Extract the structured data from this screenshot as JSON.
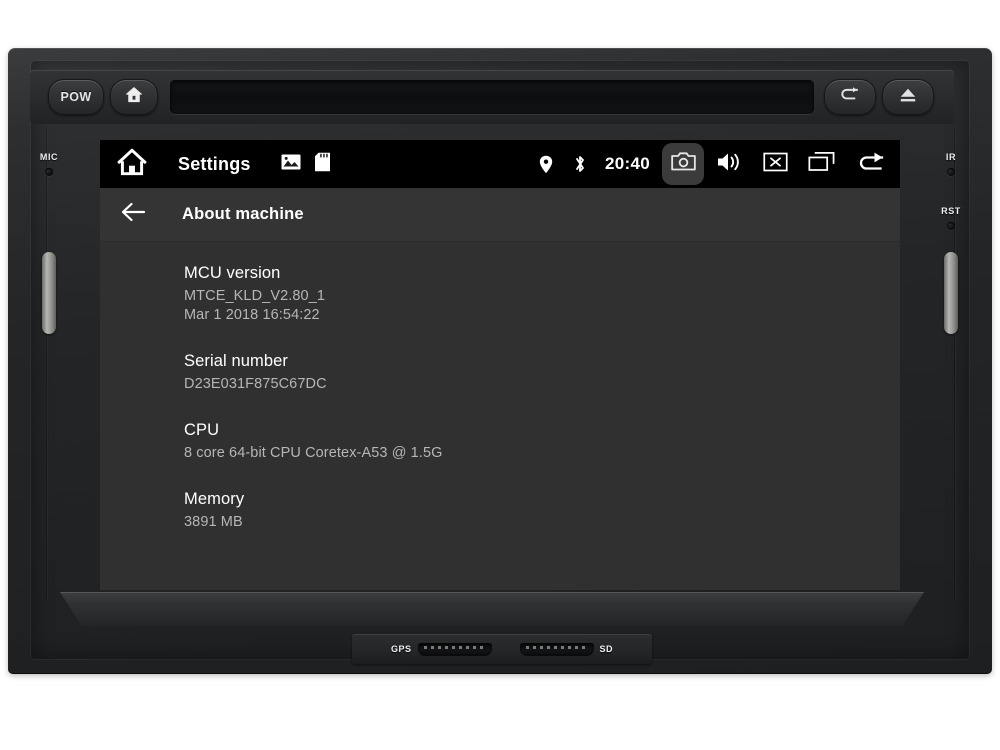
{
  "hardware": {
    "power_button_label": "POW",
    "home_button_icon": "home-icon",
    "back_button_icon": "return-arrow-icon",
    "eject_button_icon": "eject-icon",
    "left_markings": [
      {
        "label": "MIC",
        "icon": "microphone-hole"
      }
    ],
    "right_markings": [
      {
        "label": "IR",
        "icon": "infrared-hole"
      },
      {
        "label": "RST",
        "icon": "reset-hole"
      }
    ],
    "slots": [
      {
        "label": "GPS",
        "icon": "gps-card-slot"
      },
      {
        "label": "SD",
        "icon": "sd-card-slot"
      }
    ]
  },
  "screen": {
    "status_bar": {
      "home_icon": "home-icon",
      "app_title": "Settings",
      "title_icons": [
        {
          "name": "gallery-icon"
        },
        {
          "name": "sd-card-icon"
        }
      ],
      "status_icons": [
        {
          "name": "location-pin-icon"
        },
        {
          "name": "bluetooth-icon"
        }
      ],
      "clock": "20:40",
      "nav_keys": [
        {
          "name": "camera-icon",
          "highlighted": true
        },
        {
          "name": "volume-icon",
          "highlighted": false
        },
        {
          "name": "close-box-icon",
          "highlighted": false
        },
        {
          "name": "recent-apps-icon",
          "highlighted": false
        },
        {
          "name": "back-arrow-icon",
          "highlighted": false
        }
      ]
    },
    "sub_header": {
      "back_icon": "back-arrow-icon",
      "title": "About machine"
    },
    "info_items": [
      {
        "label": "MCU version",
        "value_line1": "MTCE_KLD_V2.80_1",
        "value_line2": "Mar  1 2018 16:54:22"
      },
      {
        "label": "Serial number",
        "value_line1": "D23E031F875C67DC",
        "value_line2": ""
      },
      {
        "label": "CPU",
        "value_line1": "8 core 64-bit CPU Coretex-A53 @ 1.5G",
        "value_line2": ""
      },
      {
        "label": "Memory",
        "value_line1": "3891 MB",
        "value_line2": ""
      }
    ]
  },
  "colors": {
    "screen_bg": "#303030",
    "status_bar_bg": "#000000",
    "sub_header_bg": "#343434",
    "label_text": "#ffffff",
    "value_text": "#b6b6b6",
    "highlight_bg": "#3b3b3b"
  }
}
